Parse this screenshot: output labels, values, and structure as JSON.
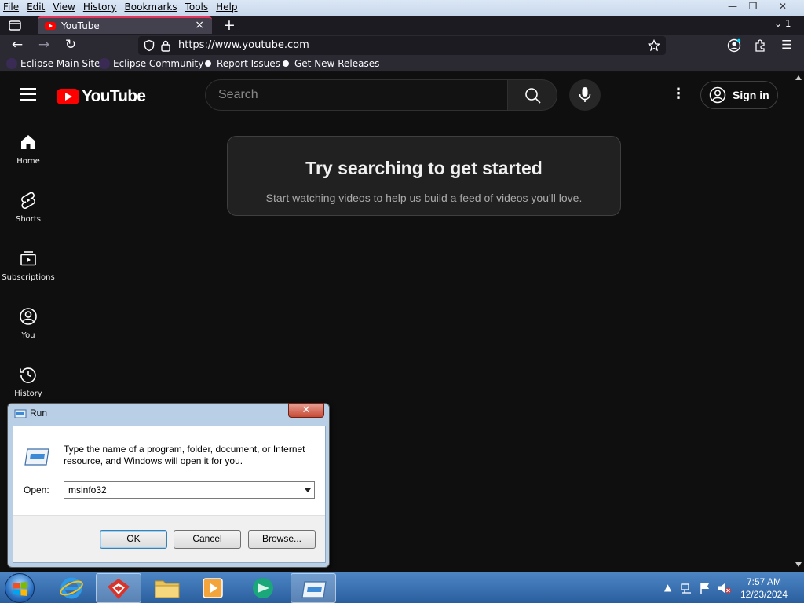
{
  "browser": {
    "menu": [
      "File",
      "Edit",
      "View",
      "History",
      "Bookmarks",
      "Tools",
      "Help"
    ],
    "tab_title": "YouTube",
    "tab_count": "1",
    "url": "https://www.youtube.com",
    "bookmarks": [
      "Eclipse Main Site",
      "Eclipse Community",
      "Report Issues",
      "Get New Releases"
    ]
  },
  "youtube": {
    "logo_text": "YouTube",
    "search_placeholder": "Search",
    "sign_in": "Sign in",
    "guide": [
      {
        "label": "Home",
        "icon": "home-icon"
      },
      {
        "label": "Shorts",
        "icon": "shorts-icon"
      },
      {
        "label": "Subscriptions",
        "icon": "subscriptions-icon"
      },
      {
        "label": "You",
        "icon": "you-icon"
      },
      {
        "label": "History",
        "icon": "history-icon"
      }
    ],
    "promo_title": "Try searching to get started",
    "promo_subtitle": "Start watching videos to help us build a feed of videos you'll love."
  },
  "run_dialog": {
    "title": "Run",
    "description": "Type the name of a program, folder, document, or Internet resource, and Windows will open it for you.",
    "open_label": "Open:",
    "open_value": "msinfo32",
    "ok": "OK",
    "cancel": "Cancel",
    "browse": "Browse..."
  },
  "taskbar": {
    "time": "7:57 AM",
    "date": "12/23/2024"
  },
  "colors": {
    "youtube_red": "#ff0000",
    "page_bg": "#0f0f0f",
    "tab_accent": "#e2335a"
  }
}
